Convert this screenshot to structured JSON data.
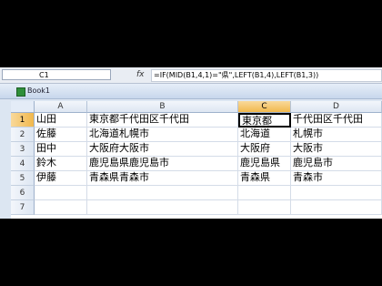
{
  "formula_bar": {
    "name_box": "C1",
    "fx_label": "fx",
    "formula": "=IF(MID(B1,4,1)=\"県\",LEFT(B1,4),LEFT(B1,3))"
  },
  "workbook": {
    "title": "Book1"
  },
  "sheet": {
    "columns": [
      "A",
      "B",
      "C",
      "D"
    ],
    "rows": [
      "1",
      "2",
      "3",
      "4",
      "5",
      "6",
      "7"
    ],
    "selected_column": "C",
    "selected_row": "1",
    "active_cell": "C1",
    "cells": [
      [
        "山田",
        "東京都千代田区千代田",
        "東京都",
        "千代田区千代田"
      ],
      [
        "佐藤",
        "北海道札幌市",
        "北海道",
        "札幌市"
      ],
      [
        "田中",
        "大阪府大阪市",
        "大阪府",
        "大阪市"
      ],
      [
        "鈴木",
        "鹿児島県鹿児島市",
        "鹿児島県",
        "鹿児島市"
      ],
      [
        "伊藤",
        "青森県青森市",
        "青森県",
        "青森市"
      ],
      [
        "",
        "",
        "",
        ""
      ],
      [
        "",
        "",
        "",
        ""
      ]
    ]
  },
  "colors": {
    "selected_header": "#f1b84c",
    "header": "#dde6f2",
    "background": "#000000"
  }
}
